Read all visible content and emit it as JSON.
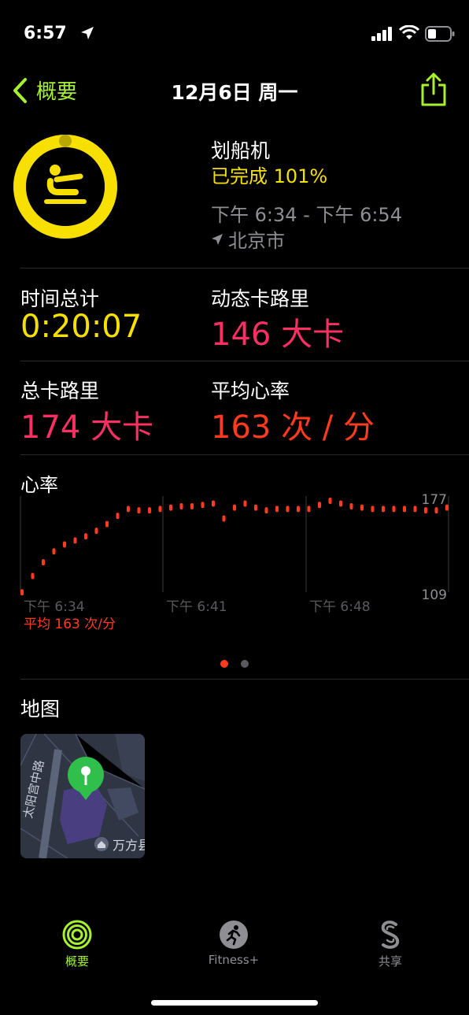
{
  "status_bar": {
    "time": "6:57"
  },
  "nav": {
    "back_label": "概要",
    "title": "12月6日 周一"
  },
  "workout": {
    "name": "划船机",
    "completion": "已完成 101%",
    "completion_fraction": 1.01,
    "time_range": "下午 6:34 - 下午 6:54",
    "location": "北京市",
    "icon": "rowing-icon"
  },
  "stats": [
    {
      "label": "时间总计",
      "value": "0:20:07",
      "color": "#f7e000"
    },
    {
      "label": "动态卡路里",
      "value": "146 大卡",
      "color": "#fc2f62"
    },
    {
      "label": "总卡路里",
      "value": "174 大卡",
      "color": "#fc2f62"
    },
    {
      "label": "平均心率",
      "value": "163 次 / 分",
      "color": "#ff3b1f"
    }
  ],
  "heart_chart": {
    "title": "心率",
    "max_label": "177",
    "min_label": "109",
    "x_ticks": [
      "下午 6:34",
      "下午 6:41",
      "下午 6:48"
    ],
    "average": "平均 163 次/分"
  },
  "chart_data": {
    "type": "scatter",
    "x_unit": "minutes",
    "ylim": [
      109,
      177
    ],
    "x": [
      0,
      0.5,
      1,
      1.5,
      2,
      2.5,
      3,
      3.5,
      4,
      4.5,
      5,
      5.5,
      6,
      6.5,
      7,
      7.5,
      8,
      8.5,
      9,
      9.5,
      10,
      10.5,
      11,
      11.5,
      12,
      12.5,
      13,
      13.5,
      14,
      14.5,
      15,
      15.5,
      16,
      16.5,
      17,
      17.5,
      18,
      18.5,
      19,
      19.5,
      20
    ],
    "y": [
      110,
      122,
      132,
      140,
      145,
      148,
      151,
      155,
      160,
      166,
      171,
      170,
      170,
      171,
      172,
      173,
      173,
      174,
      175,
      164,
      172,
      175,
      172,
      170,
      171,
      171,
      171,
      171,
      174,
      177,
      175,
      173,
      172,
      171,
      171,
      171,
      171,
      171,
      170,
      170,
      172
    ],
    "colors": {
      "points": "#ff3b1f",
      "grid": "#3a3a3c",
      "labels": "#8e8e93"
    }
  },
  "pager": {
    "active_index": 0,
    "count": 2
  },
  "map": {
    "title": "地图",
    "road_label": "太阳宫中路",
    "poi_label": "万方县"
  },
  "tabs": [
    {
      "label": "概要",
      "icon": "activity-rings-icon",
      "active": true
    },
    {
      "label": "Fitness+",
      "icon": "fitness-runner-icon",
      "active": false
    },
    {
      "label": "共享",
      "icon": "sharing-icon",
      "active": false
    }
  ],
  "colors": {
    "accent": "#a6f22e",
    "move": "#fc2f62",
    "exercise": "#f7e000",
    "heart": "#ff3b1f"
  }
}
